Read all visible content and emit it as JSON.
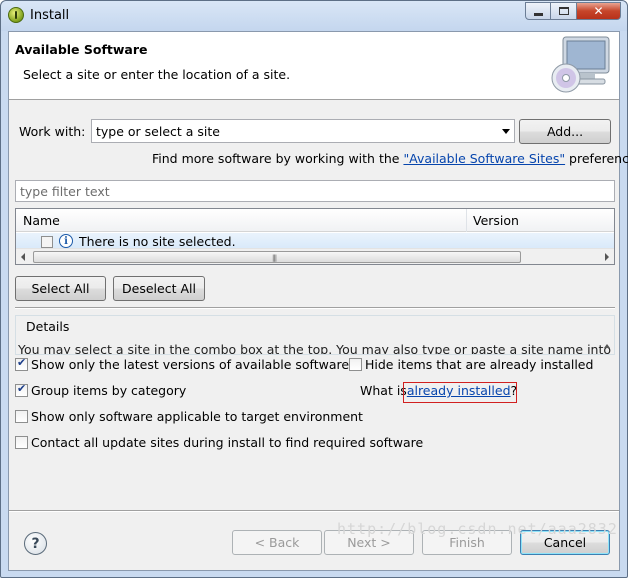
{
  "window": {
    "title": "Install"
  },
  "header": {
    "title": "Available Software",
    "description": "Select a site or enter the location of a site."
  },
  "work_with": {
    "label": "Work with:",
    "value": "type or select a site",
    "add_label": "Add...",
    "more_prefix": "Find more software by working with the ",
    "more_link": "\"Available Software Sites\"",
    "more_suffix": " preferences."
  },
  "filter": {
    "placeholder": "type filter text"
  },
  "table": {
    "columns": [
      "Name",
      "Version"
    ],
    "rows": [
      {
        "text": "There is no site selected."
      }
    ]
  },
  "select_all_label": "Select All",
  "deselect_all_label": "Deselect All",
  "details": {
    "label": "Details",
    "text": "You may select a site in the combo box at the top. You may also type or paste a site name into"
  },
  "options": {
    "latest_versions": {
      "label": "Show only the latest versions of available software",
      "checked": true
    },
    "hide_installed": {
      "label": "Hide items that are already installed",
      "checked": false
    },
    "group_by_category": {
      "label": "Group items by category",
      "checked": true
    },
    "what_is_prefix": "What is ",
    "already_installed_link": "already installed",
    "what_is_suffix": "?",
    "target_environment": {
      "label": "Show only software applicable to target environment",
      "checked": false
    },
    "contact_sites": {
      "label": "Contact all update sites during install to find required software",
      "checked": false
    }
  },
  "footer": {
    "back_label": "< Back",
    "next_label": "Next >",
    "finish_label": "Finish",
    "cancel_label": "Cancel"
  },
  "watermark": "http://blog.csdn.net/aaa2832"
}
